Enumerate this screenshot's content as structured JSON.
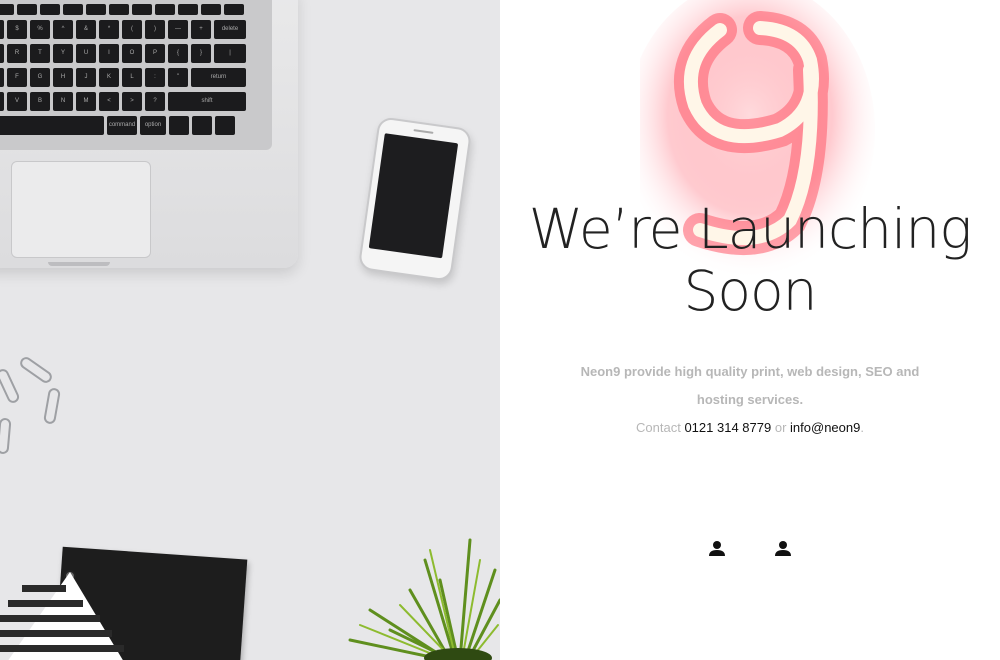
{
  "hero": {
    "heading_line1": "We’re Launching",
    "heading_line2": "Soon",
    "logo_digit": "9",
    "description": "Neon9 provide high quality print, web design, SEO and hosting services.",
    "contact_prefix": "Contact",
    "phone": "0121 314 8779",
    "contact_or": "or",
    "email": "info@neon9",
    "contact_suffix": "."
  },
  "social": [
    {
      "icon": "user-icon"
    },
    {
      "icon": "user-icon"
    }
  ],
  "keyboard": {
    "row_fn": [
      "",
      "",
      "",
      "",
      "",
      "",
      "",
      "",
      "",
      "",
      "",
      ""
    ],
    "row1": [
      "#",
      "$",
      "%",
      "^",
      "&",
      "*",
      "(",
      ")",
      "—",
      "+",
      "delete"
    ],
    "row2": [
      "E",
      "R",
      "T",
      "Y",
      "U",
      "I",
      "O",
      "P",
      "{",
      "}",
      "|"
    ],
    "row3": [
      "D",
      "F",
      "G",
      "H",
      "J",
      "K",
      "L",
      ":",
      "\"",
      "return"
    ],
    "row4": [
      "C",
      "V",
      "B",
      "N",
      "M",
      "<",
      ">",
      "?",
      "shift"
    ],
    "row5": [
      "",
      "command",
      "option",
      "",
      "",
      ""
    ]
  },
  "colors": {
    "neon_tube": "#fff6e8",
    "neon_glow": "#ff5a6a",
    "text_muted": "#b7b7b7",
    "text_dark": "#111111"
  }
}
